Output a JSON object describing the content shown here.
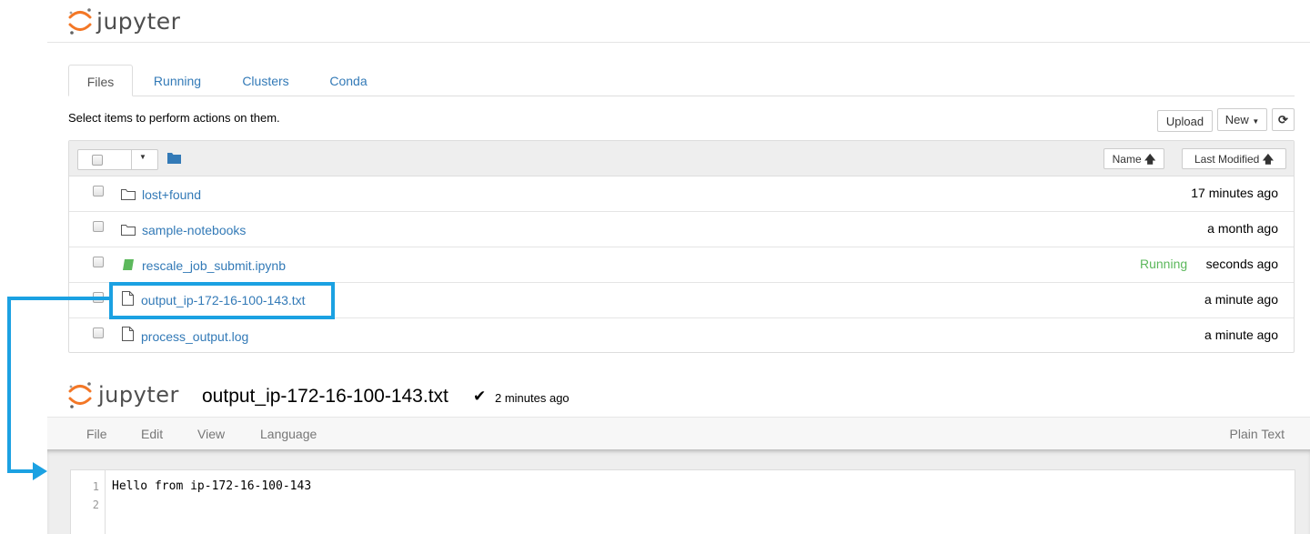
{
  "brand": {
    "name": "jupyter"
  },
  "tabs": [
    "Files",
    "Running",
    "Clusters",
    "Conda"
  ],
  "hint": "Select items to perform actions on them.",
  "toolbar": {
    "upload": "Upload",
    "new": "New",
    "refresh_icon": "refresh-icon"
  },
  "sort": {
    "name": "Name",
    "modified": "Last Modified"
  },
  "files": [
    {
      "name": "lost+found",
      "icon": "folder-icon",
      "modified": "17 minutes ago",
      "status": ""
    },
    {
      "name": "sample-notebooks",
      "icon": "folder-icon",
      "modified": "a month ago",
      "status": ""
    },
    {
      "name": "rescale_job_submit.ipynb",
      "icon": "notebook-icon",
      "modified": "seconds ago",
      "status": "Running"
    },
    {
      "name": "output_ip-172-16-100-143.txt",
      "icon": "file-icon",
      "modified": "a minute ago",
      "status": ""
    },
    {
      "name": "process_output.log",
      "icon": "file-icon",
      "modified": "a minute ago",
      "status": ""
    }
  ],
  "editor": {
    "filename": "output_ip-172-16-100-143.txt",
    "saved": "2 minutes ago",
    "menu": [
      "File",
      "Edit",
      "View",
      "Language"
    ],
    "mode": "Plain Text",
    "line_numbers": [
      "1",
      "2"
    ],
    "lines": [
      "Hello from ip-172-16-100-143",
      ""
    ]
  },
  "colors": {
    "accent": "#337ab7",
    "highlight": "#1ba1e2",
    "running": "#5cb85c",
    "logo": "#f37726"
  }
}
